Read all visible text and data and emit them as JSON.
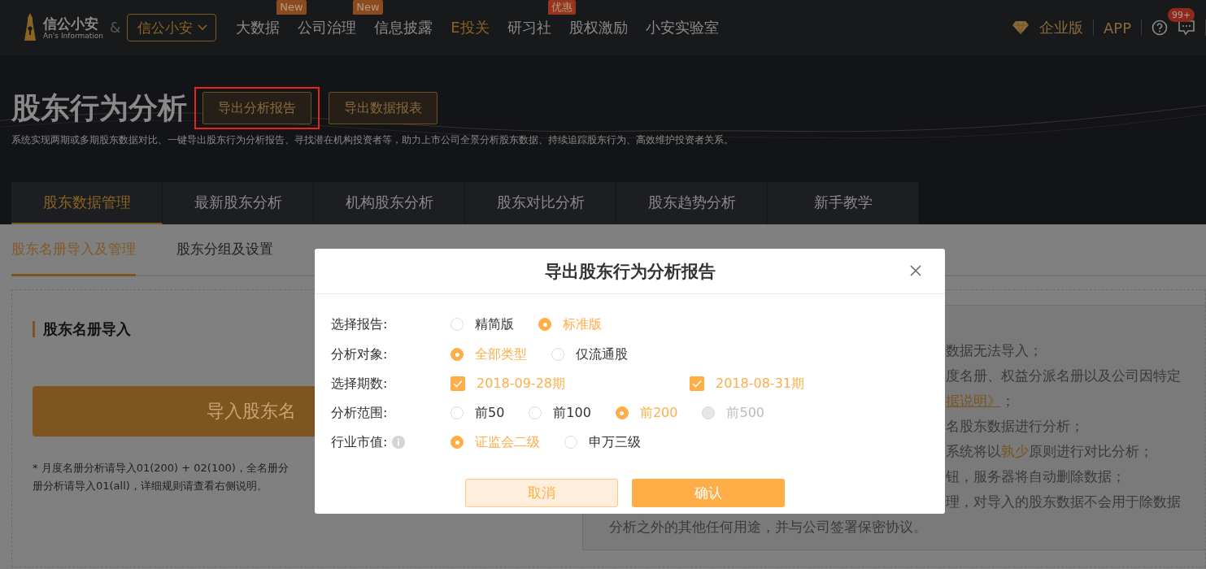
{
  "nav": {
    "logo_name": "信公小安",
    "logo_subtitle": "An's Information",
    "ampersand": "&",
    "product_select": "信公小安",
    "items": [
      {
        "label": "大数据",
        "highlight": false,
        "badge": {
          "text": "New",
          "color": "#8c4b1e"
        }
      },
      {
        "label": "公司治理",
        "highlight": false,
        "badge": {
          "text": "New",
          "color": "#8c4b1e"
        }
      },
      {
        "label": "信息披露",
        "highlight": false
      },
      {
        "label": "E投关",
        "highlight": true
      },
      {
        "label": "研习社",
        "highlight": false,
        "badge": {
          "text": "优惠",
          "color": "#96351c"
        }
      },
      {
        "label": "股权激励",
        "highlight": false
      },
      {
        "label": "小安实验室",
        "highlight": false
      }
    ],
    "enterprise": "企业版",
    "app": "APP",
    "notification_count": "99+"
  },
  "header": {
    "title": "股东行为分析",
    "actions": [
      {
        "label": "导出分析报告",
        "annotated": true
      },
      {
        "label": "导出数据报表",
        "annotated": false
      }
    ],
    "description": "系统实现两期或多期股东数据对比、一键导出股东行为分析报告、寻找潜在机构投资者等，助力上市公司全景分析股东数据、持续追踪股东行为、高效维护投资者关系。"
  },
  "tabs": [
    {
      "label": "股东数据管理",
      "selected": true
    },
    {
      "label": "最新股东分析",
      "selected": false
    },
    {
      "label": "机构股东分析",
      "selected": false
    },
    {
      "label": "股东对比分析",
      "selected": false
    },
    {
      "label": "股东趋势分析",
      "selected": false
    },
    {
      "label": "新手教学",
      "selected": false
    }
  ],
  "subtabs": [
    {
      "label": "股东名册导入及管理",
      "selected": true
    },
    {
      "label": "股东分组及设置",
      "selected": false
    }
  ],
  "import_card": {
    "title": "股东名册导入",
    "button": "导入股东名",
    "note_lines": [
      "* 月度名册分析请导入01(200) + 02(100)，全名册分",
      "册分析请导入01(all)，详细规则请查看右侧说明。"
    ]
  },
  "rules_panel": {
    "lines": [
      {
        "cut": true,
        "segments": [
          {
            "kind": "plain",
            "text": "数据无法导入；"
          }
        ]
      },
      {
        "cut": true,
        "segments": [
          {
            "kind": "plain",
            "text": "度名册、权益分派名册以及公司因特定"
          }
        ]
      },
      {
        "cut": true,
        "segments": [
          {
            "kind": "link",
            "text": "据说明》"
          },
          {
            "kind": "plain",
            "text": "；"
          }
        ]
      },
      {
        "cut": true,
        "segments": [
          {
            "kind": "plain",
            "text": "名股东数据进行分析；"
          }
        ]
      },
      {
        "cut": true,
        "segments": [
          {
            "kind": "plain",
            "text": "系统将以"
          },
          {
            "kind": "emphasis",
            "text": "孰少"
          },
          {
            "kind": "plain",
            "text": "原则进行对比分析；"
          }
        ]
      },
      {
        "cut": true,
        "segments": [
          {
            "kind": "plain",
            "text": "钮，服务器将自动删除数据；"
          }
        ]
      },
      {
        "cut": true,
        "segments": [
          {
            "kind": "plain",
            "text": "理，对导入的股东数据不会用于除数据"
          }
        ]
      },
      {
        "cut": false,
        "segments": [
          {
            "kind": "plain",
            "text": "分析之外的其他任何用途，并与公司签署保密协议。"
          }
        ]
      }
    ]
  },
  "modal": {
    "title": "导出股东行为分析报告",
    "rows": [
      {
        "label": "选择报告:",
        "kind": "radio",
        "info": false,
        "options": [
          {
            "label": "精简版",
            "selected": false,
            "disabled": false
          },
          {
            "label": "标准版",
            "selected": true,
            "disabled": false
          }
        ]
      },
      {
        "label": "分析对象:",
        "kind": "radio",
        "info": false,
        "options": [
          {
            "label": "全部类型",
            "selected": true,
            "disabled": false
          },
          {
            "label": "仅流通股",
            "selected": false,
            "disabled": false
          }
        ]
      },
      {
        "label": "选择期数:",
        "kind": "checkbox",
        "info": false,
        "options": [
          {
            "label": "2018-09-28期",
            "checked": true
          },
          {
            "label": "2018-08-31期",
            "checked": true
          }
        ]
      },
      {
        "label": "分析范围:",
        "kind": "radio",
        "info": false,
        "options": [
          {
            "label": "前50",
            "selected": false,
            "disabled": false
          },
          {
            "label": "前100",
            "selected": false,
            "disabled": false
          },
          {
            "label": "前200",
            "selected": true,
            "disabled": false
          },
          {
            "label": "前500",
            "selected": false,
            "disabled": true
          }
        ]
      },
      {
        "label": "行业市值:",
        "kind": "radio",
        "info": true,
        "options": [
          {
            "label": "证监会二级",
            "selected": true,
            "disabled": false
          },
          {
            "label": "申万三级",
            "selected": false,
            "disabled": false
          }
        ]
      }
    ],
    "buttons": [
      {
        "label": "取消",
        "kind": "secondary"
      },
      {
        "label": "确认",
        "kind": "primary"
      }
    ]
  }
}
